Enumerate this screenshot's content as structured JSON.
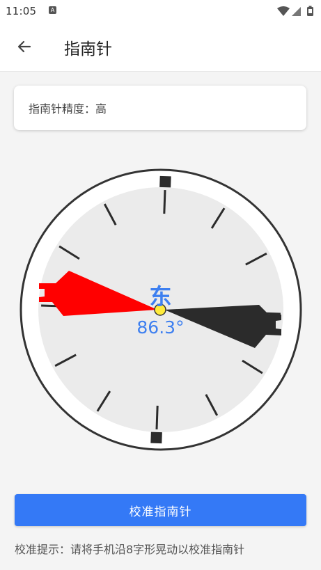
{
  "status_bar": {
    "time": "11:05",
    "notification_icon": "A",
    "icons": [
      "wifi-icon",
      "cellular-signal-icon",
      "battery-icon"
    ]
  },
  "app_bar": {
    "back_icon": "arrow-left-icon",
    "title": "指南针"
  },
  "accuracy": {
    "text": "指南针精度：高"
  },
  "compass": {
    "direction": "东",
    "heading": "86.3°",
    "heading_degrees": 86.3,
    "colors": {
      "north_needle": "#ff0000",
      "south_needle": "#2b2b2b",
      "center_dot": "#ffeb3b",
      "text": "#3d7ff0"
    }
  },
  "calibrate_button": {
    "label": "校准指南针",
    "color": "#3479f6"
  },
  "hint": {
    "text": "校准提示：请将手机沿8字形晃动以校准指南针"
  }
}
